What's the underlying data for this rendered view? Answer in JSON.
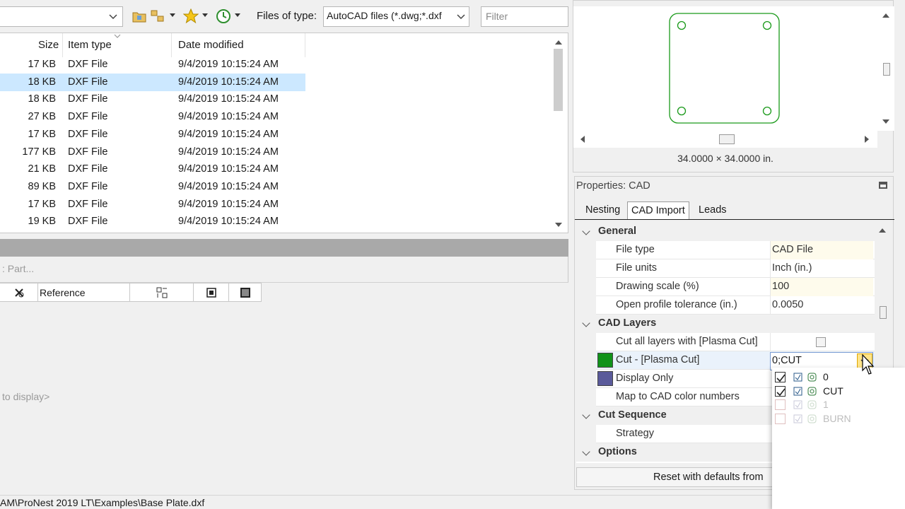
{
  "toolbar": {
    "files_of_type_label": "Files of type:",
    "files_of_type_value": "AutoCAD files (*.dwg;*.dxf",
    "filter_placeholder": "Filter"
  },
  "file_list": {
    "columns": [
      "Size",
      "Item type",
      "Date modified"
    ],
    "rows": [
      {
        "size": "17 KB",
        "type": "DXF File",
        "date": "9/4/2019 10:15:24 AM",
        "selected": false
      },
      {
        "size": "18 KB",
        "type": "DXF File",
        "date": "9/4/2019 10:15:24 AM",
        "selected": true
      },
      {
        "size": "18 KB",
        "type": "DXF File",
        "date": "9/4/2019 10:15:24 AM",
        "selected": false
      },
      {
        "size": "27 KB",
        "type": "DXF File",
        "date": "9/4/2019 10:15:24 AM",
        "selected": false
      },
      {
        "size": "17 KB",
        "type": "DXF File",
        "date": "9/4/2019 10:15:24 AM",
        "selected": false
      },
      {
        "size": "177 KB",
        "type": "DXF File",
        "date": "9/4/2019 10:15:24 AM",
        "selected": false
      },
      {
        "size": "21 KB",
        "type": "DXF File",
        "date": "9/4/2019 10:15:24 AM",
        "selected": false
      },
      {
        "size": "89 KB",
        "type": "DXF File",
        "date": "9/4/2019 10:15:24 AM",
        "selected": false
      },
      {
        "size": "17 KB",
        "type": "DXF File",
        "date": "9/4/2019 10:15:24 AM",
        "selected": false
      },
      {
        "size": "19 KB",
        "type": "DXF File",
        "date": "9/4/2019 10:15:24 AM",
        "selected": false
      }
    ]
  },
  "part_area": {
    "part_label": ": Part...",
    "reference_header": "Reference",
    "empty_text": "to display>"
  },
  "status_bar": {
    "path": "AM\\ProNest 2019 LT\\Examples\\Base Plate.dxf"
  },
  "preview": {
    "dimensions": "34.0000 × 34.0000 in.",
    "outline_color": "#1a9a1a"
  },
  "properties": {
    "title": "Properties: CAD",
    "tabs": [
      {
        "label": "Nesting",
        "active": false
      },
      {
        "label": "CAD Import",
        "active": true
      },
      {
        "label": "Leads",
        "active": false
      }
    ],
    "categories": {
      "general": "General",
      "cad_layers": "CAD Layers",
      "cut_sequence": "Cut Sequence",
      "options": "Options"
    },
    "general_rows": [
      {
        "name": "File type",
        "value": "CAD File"
      },
      {
        "name": "File units",
        "value": "Inch (in.)"
      },
      {
        "name": "Drawing scale (%)",
        "value": "100"
      },
      {
        "name": "Open profile tolerance (in.)",
        "value": "0.0050"
      }
    ],
    "layer_rows": {
      "cut_all": "Cut all layers with [Plasma Cut]",
      "cut": "Cut - [Plasma Cut]",
      "cut_value": "0;CUT",
      "display_only": "Display Only",
      "map_colors": "Map to CAD color numbers"
    },
    "strategy": "Strategy",
    "reset_button": "Reset with defaults from",
    "swatch_cut": "#10921a",
    "swatch_display": "#5a5a9a"
  },
  "layer_dropdown": {
    "items": [
      {
        "label": "0",
        "checked": true,
        "enabled": true
      },
      {
        "label": "CUT",
        "checked": true,
        "enabled": true
      },
      {
        "label": "1",
        "checked": false,
        "enabled": false
      },
      {
        "label": "BURN",
        "checked": false,
        "enabled": false
      }
    ]
  }
}
